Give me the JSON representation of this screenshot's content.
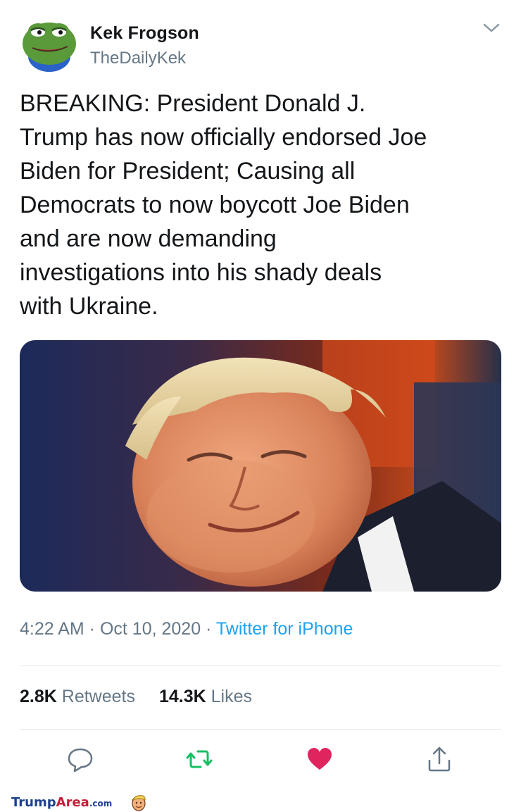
{
  "tweet": {
    "author_name": "Kek Frogson",
    "author_handle": "TheDailyKek",
    "text": "BREAKING: President Donald J.\nTrump has now officially endorsed Joe\nBiden for President; Causing all\nDemocrats to now boycott Joe Biden\nand are now demanding\ninvestigations into his shady deals\nwith Ukraine.",
    "time": "4:22 AM",
    "date": "Oct 10, 2020",
    "sep": " · ",
    "source": "Twitter for iPhone",
    "retweets_count": "2.8K",
    "retweets_label": "Retweets",
    "likes_count": "14.3K",
    "likes_label": "Likes"
  },
  "icons": {
    "avatar": "pepe-frog-avatar",
    "menu": "chevron-down-icon",
    "reply": "reply-icon",
    "retweet": "retweet-icon",
    "like": "heart-icon",
    "share": "share-icon"
  },
  "colors": {
    "link": "#1da1f2",
    "retweet": "#17bf63",
    "like": "#e0245e",
    "muted": "#657786"
  },
  "footer": {
    "brand_prefix": "Trump",
    "brand_highlight": "Area",
    "brand_domain": ".com"
  }
}
